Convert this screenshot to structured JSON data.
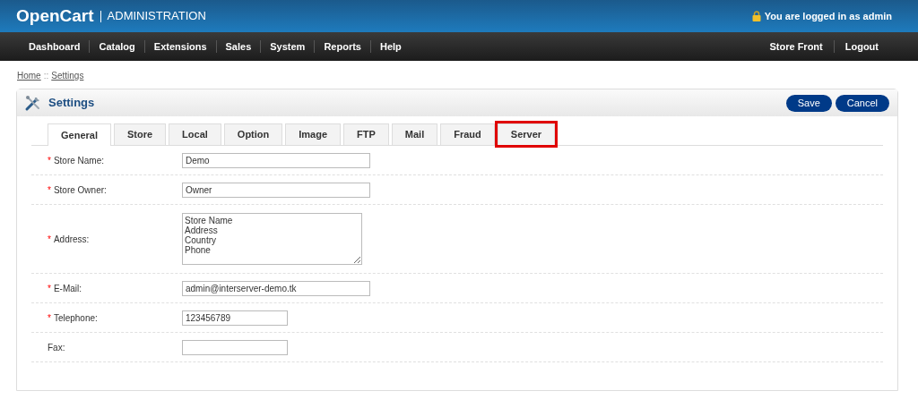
{
  "header": {
    "logo": "OpenCart",
    "subtitle": "ADMINISTRATION",
    "login_text": "You are logged in as admin"
  },
  "menu": {
    "left": [
      "Dashboard",
      "Catalog",
      "Extensions",
      "Sales",
      "System",
      "Reports",
      "Help"
    ],
    "right": [
      "Store Front",
      "Logout"
    ]
  },
  "breadcrumb": [
    {
      "label": "Home"
    },
    {
      "label": "Settings"
    }
  ],
  "breadcrumb_separator": "::",
  "panel": {
    "title": "Settings",
    "buttons": [
      "Save",
      "Cancel"
    ]
  },
  "tabs": [
    {
      "label": "General",
      "selected": true,
      "highlighted": false
    },
    {
      "label": "Store",
      "selected": false,
      "highlighted": false
    },
    {
      "label": "Local",
      "selected": false,
      "highlighted": false
    },
    {
      "label": "Option",
      "selected": false,
      "highlighted": false
    },
    {
      "label": "Image",
      "selected": false,
      "highlighted": false
    },
    {
      "label": "FTP",
      "selected": false,
      "highlighted": false
    },
    {
      "label": "Mail",
      "selected": false,
      "highlighted": false
    },
    {
      "label": "Fraud",
      "selected": false,
      "highlighted": false
    },
    {
      "label": "Server",
      "selected": false,
      "highlighted": true
    }
  ],
  "fields": [
    {
      "label": "Store Name:",
      "required_mark": "*",
      "kind": "text",
      "value": "Demo"
    },
    {
      "label": "Store Owner:",
      "required_mark": "*",
      "kind": "text",
      "value": "Owner"
    },
    {
      "label": "Address:",
      "required_mark": "*",
      "kind": "textarea",
      "value": "Store Name\nAddress\nCountry\nPhone"
    },
    {
      "label": "E-Mail:",
      "required_mark": "*",
      "kind": "text",
      "value": "admin@interserver-demo.tk"
    },
    {
      "label": "Telephone:",
      "required_mark": "*",
      "kind": "short_text",
      "value": "123456789"
    },
    {
      "label": "Fax:",
      "kind": "short_text"
    }
  ]
}
